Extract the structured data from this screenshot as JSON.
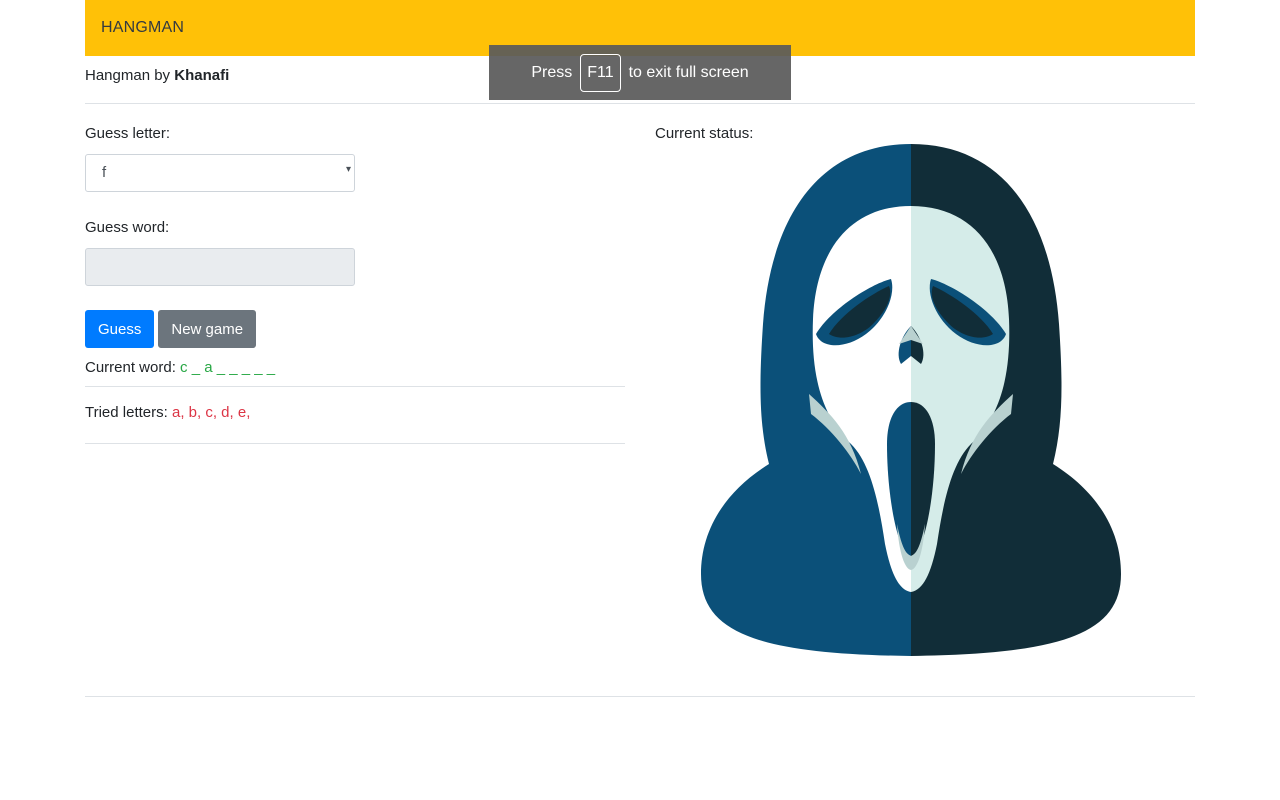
{
  "navbar": {
    "brand": "HANGMAN"
  },
  "byline": {
    "prefix": "Hangman by",
    "author": "Khanafi"
  },
  "guess_letter": {
    "label": "Guess letter:",
    "selected": "f"
  },
  "guess_word": {
    "label": "Guess word:",
    "value": ""
  },
  "buttons": {
    "guess": "Guess",
    "new_game": "New game"
  },
  "current_word": {
    "label": "Current word:",
    "value": "c _ a _ _ _ _ _"
  },
  "tried_letters": {
    "label": "Tried letters:",
    "value": "a, b, c, d, e,"
  },
  "status": {
    "label": "Current status:",
    "image": "ghostface-mask-icon"
  },
  "fullscreen_notice": {
    "press": "Press",
    "key": "F11",
    "suffix": "to exit full screen"
  },
  "colors": {
    "navbar": "#ffc107",
    "primary": "#007bff",
    "secondary": "#6c757d",
    "green": "#28a745",
    "red": "#dc3545",
    "hood_left": "#0b5079",
    "hood_right": "#112d38",
    "mask_left": "#ffffff",
    "mask_right": "#d5ece9"
  }
}
